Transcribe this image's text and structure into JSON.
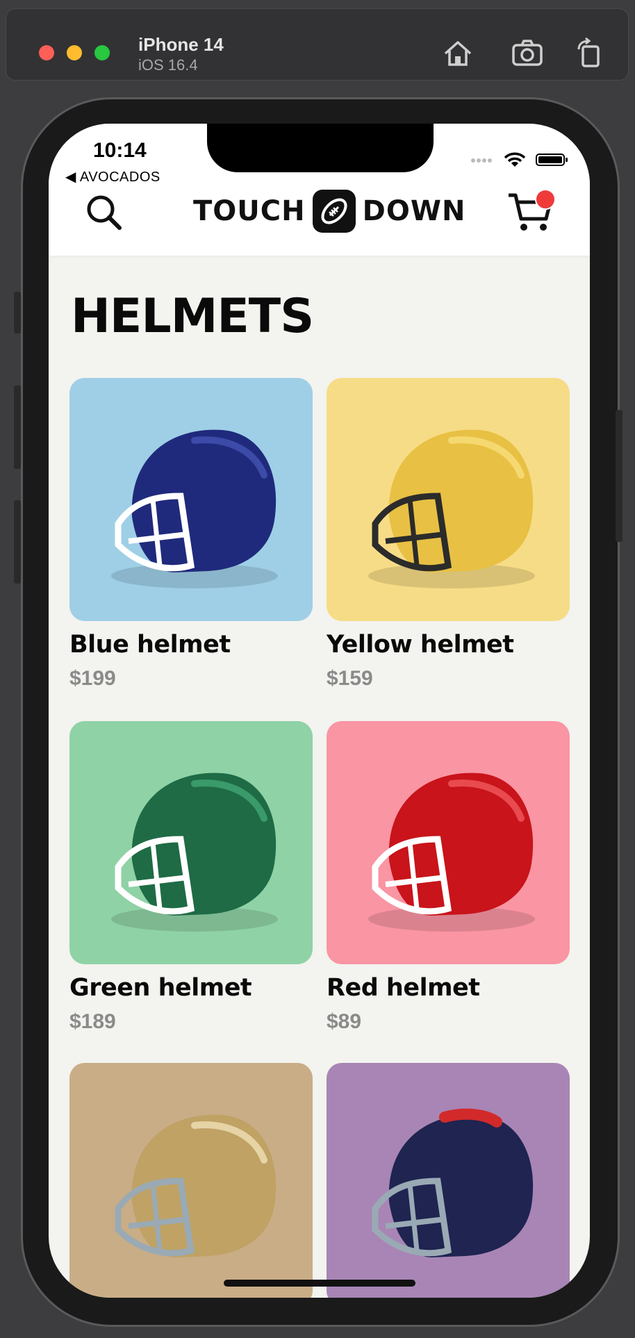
{
  "simulator": {
    "device_name": "iPhone 14",
    "os_version": "iOS 16.4",
    "buttons": [
      "home-icon",
      "screenshot-icon",
      "rotate-icon"
    ]
  },
  "status_bar": {
    "time": "10:14",
    "back_label": "◀ AVOCADOS"
  },
  "header": {
    "logo_left": "TOUCH",
    "logo_right": "DOWN",
    "search_icon": "search-icon",
    "cart_icon": "cart-icon",
    "cart_badge_color": "#f03a3a"
  },
  "page": {
    "title": "HELMETS"
  },
  "products": [
    {
      "name": "Blue helmet",
      "price": "$199",
      "bg": "#9fcfe6",
      "shell": "#1f2a7c"
    },
    {
      "name": "Yellow helmet",
      "price": "$159",
      "bg": "#f6dc86",
      "shell": "#e8c043"
    },
    {
      "name": "Green helmet",
      "price": "$189",
      "bg": "#8fd2a6",
      "shell": "#1e6b45"
    },
    {
      "name": "Red helmet",
      "price": "$89",
      "bg": "#fa95a3",
      "shell": "#c8141a"
    },
    {
      "name": "",
      "price": "",
      "bg": "#c9ad86",
      "shell": "#bfa264"
    },
    {
      "name": "",
      "price": "",
      "bg": "#a885b5",
      "shell": "#1f2450"
    }
  ]
}
